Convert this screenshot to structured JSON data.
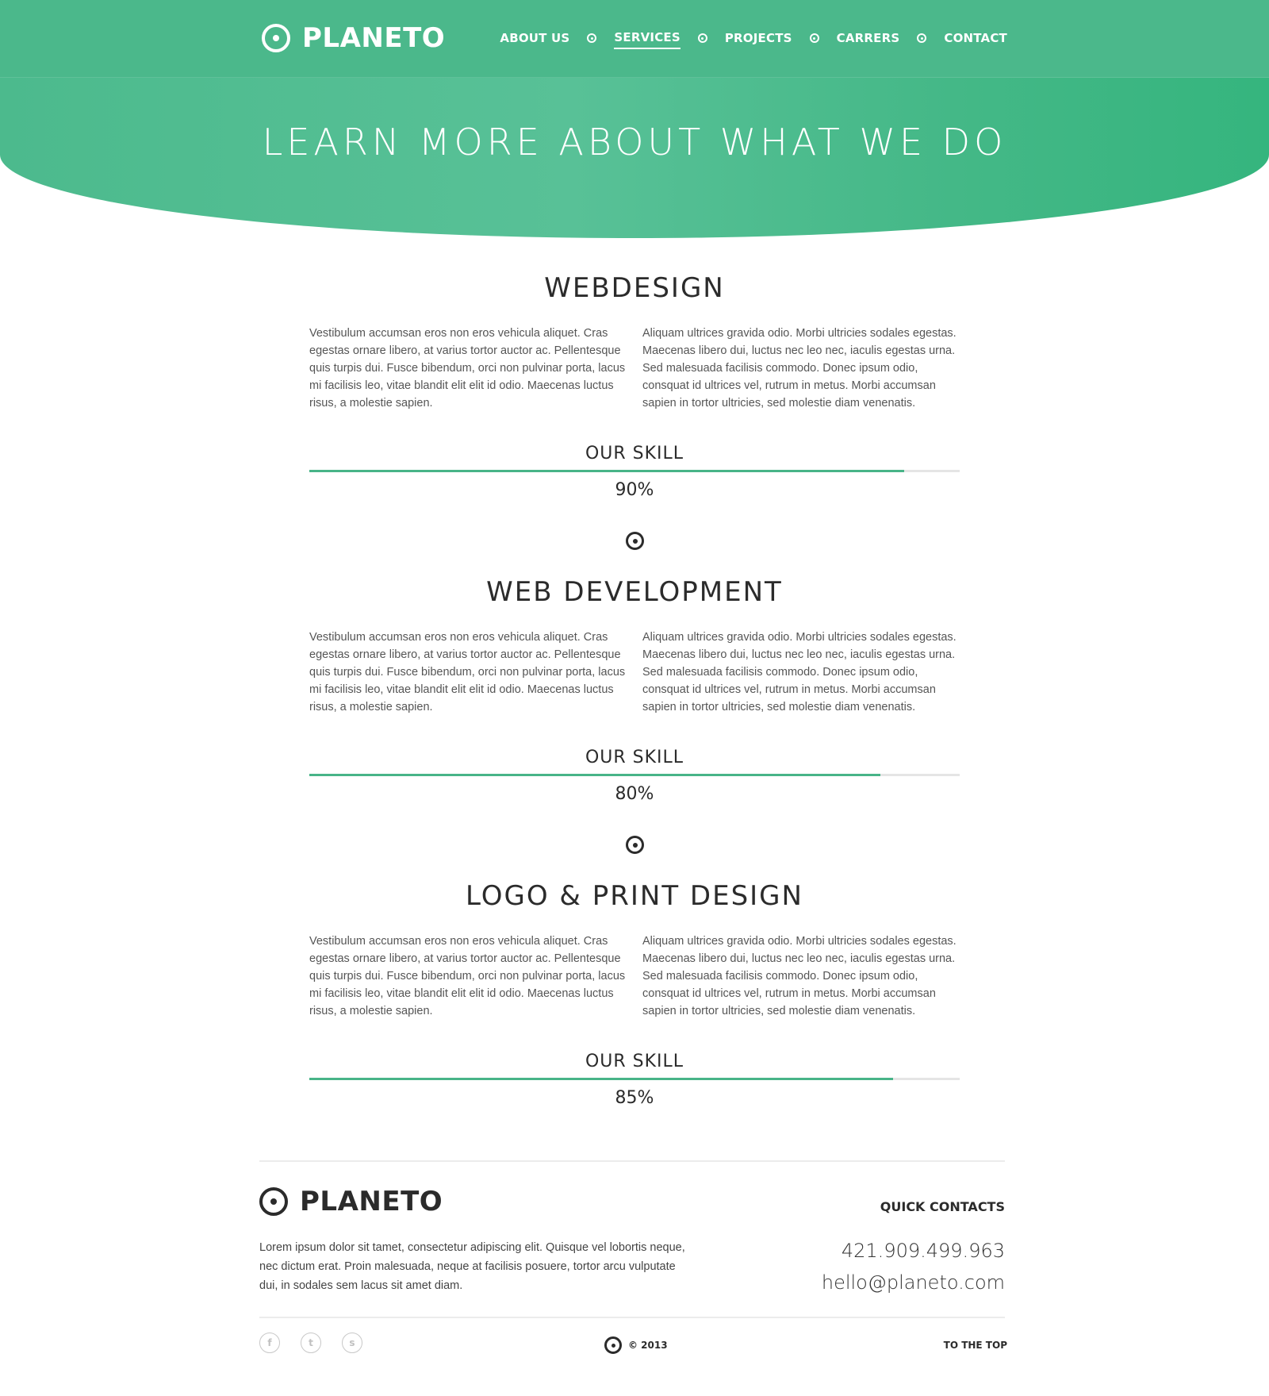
{
  "header": {
    "logo_text": "PLANETO",
    "nav": [
      {
        "label": "ABOUT US"
      },
      {
        "label": "SERVICES",
        "active": true
      },
      {
        "label": "PROJECTS"
      },
      {
        "label": "CARRERS"
      },
      {
        "label": "CONTACT"
      }
    ]
  },
  "hero": {
    "title": "LEARN MORE ABOUT WHAT WE DO"
  },
  "services": [
    {
      "title": "WEBDESIGN",
      "left_text": "Vestibulum accumsan eros non eros vehicula aliquet. Cras egestas ornare libero, at varius tortor auctor ac. Pellentesque quis turpis dui. Fusce bibendum, orci non pulvinar porta, lacus mi facilisis leo, vitae blandit elit elit id odio. Maecenas luctus risus, a molestie sapien.",
      "right_text": "Aliquam ultrices gravida odio. Morbi ultricies sodales egestas. Maecenas libero dui, luctus nec leo nec, iaculis egestas urna. Sed malesuada facilisis commodo. Donec ipsum odio, consquat id ultrices vel, rutrum in metus. Morbi accumsan sapien in tortor ultricies, sed molestie diam venenatis.",
      "skill_label": "OUR SKILL",
      "skill_value": "90%",
      "skill_fraction": 0.915
    },
    {
      "title": "WEB DEVELOPMENT",
      "left_text": "Vestibulum accumsan eros non eros vehicula aliquet. Cras egestas ornare libero, at varius tortor auctor ac. Pellentesque quis turpis dui. Fusce bibendum, orci non pulvinar porta, lacus mi facilisis leo, vitae blandit elit elit id odio. Maecenas luctus risus, a molestie sapien.",
      "right_text": "Aliquam ultrices gravida odio. Morbi ultricies sodales egestas. Maecenas libero dui, luctus nec leo nec, iaculis egestas urna. Sed malesuada facilisis commodo. Donec ipsum odio, consquat id ultrices vel, rutrum in metus. Morbi accumsan sapien in tortor ultricies, sed molestie diam venenatis.",
      "skill_label": "OUR SKILL",
      "skill_value": "80%",
      "skill_fraction": 0.878
    },
    {
      "title": "LOGO & PRINT DESIGN",
      "left_text": "Vestibulum accumsan eros non eros vehicula aliquet. Cras egestas ornare libero, at varius tortor auctor ac. Pellentesque quis turpis dui. Fusce bibendum, orci non pulvinar porta, lacus mi facilisis leo, vitae blandit elit elit id odio. Maecenas luctus risus, a molestie sapien.",
      "right_text": "Aliquam ultrices gravida odio. Morbi ultricies sodales egestas. Maecenas libero dui, luctus nec leo nec, iaculis egestas urna. Sed malesuada facilisis commodo. Donec ipsum odio, consquat id ultrices vel, rutrum in metus. Morbi accumsan sapien in tortor ultricies, sed molestie diam venenatis.",
      "skill_label": "OUR SKILL",
      "skill_value": "85%",
      "skill_fraction": 0.898
    }
  ],
  "footer": {
    "logo_text": "PLANETO",
    "description": "Lorem ipsum dolor sit tamet, consectetur adipiscing elit. Quisque vel lobortis neque, nec dictum erat. Proin malesuada, neque at facilisis posuere, tortor arcu vulputate dui, in sodales sem lacus sit amet diam.",
    "quick_contacts_title": "QUICK CONTACTS",
    "phone": "421.909.499.963",
    "email": "hello@planeto.com",
    "social": [
      {
        "icon": "facebook-icon",
        "glyph": "f"
      },
      {
        "icon": "twitter-icon",
        "glyph": "t"
      },
      {
        "icon": "skype-icon",
        "glyph": "s"
      }
    ],
    "copyright": "© 2013",
    "to_top": "TO THE TOP"
  },
  "colors": {
    "brand_green": "#4bb88b",
    "skill_bar": "#48b488",
    "text_dark": "#2b2b2b"
  }
}
